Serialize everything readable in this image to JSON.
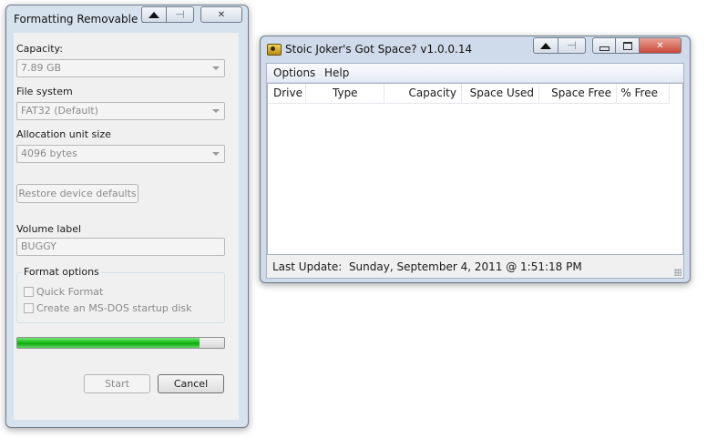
{
  "format_dialog": {
    "title": "Formatting Removable Dis",
    "capacity_label": "Capacity:",
    "capacity_value": "7.89 GB",
    "filesystem_label": "File system",
    "filesystem_value": "FAT32 (Default)",
    "allocation_label": "Allocation unit size",
    "allocation_value": "4096 bytes",
    "restore_button": "Restore device defaults",
    "volume_label": "Volume label",
    "volume_value": "BUGGY",
    "format_options_label": "Format options",
    "quick_format_label": "Quick Format",
    "msdos_label": "Create an MS-DOS startup disk",
    "progress_percent": 88,
    "start_button": "Start",
    "cancel_button": "Cancel",
    "close_glyph": "✕"
  },
  "space_app": {
    "title": "Stoic Joker's Got Space? v1.0.0.14",
    "menu": [
      "Options",
      "Help"
    ],
    "columns": [
      "Drive",
      "Type",
      "Capacity",
      "Space Used",
      "Space Free",
      "% Free"
    ],
    "status": "Last Update:  Sunday, September 4, 2011 @ 1:51:18 PM",
    "close_glyph": "✕"
  },
  "colors": {
    "progress_green": "#16c016",
    "close_red": "#c9473a"
  }
}
